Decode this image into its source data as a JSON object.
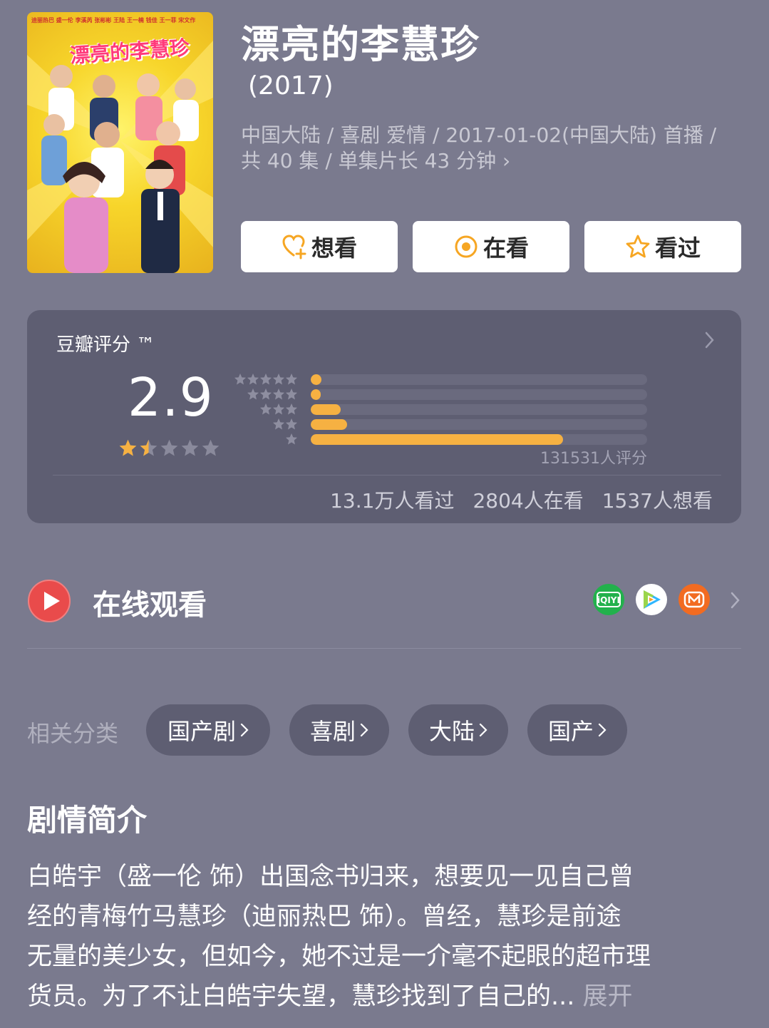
{
  "movie": {
    "poster": {
      "cast_names": "迪丽热巴  盛一伦  李溪芮  张彬彬  王陆  王一楠  钱佳  王一菲  宋文作",
      "title": "漂亮的李慧珍"
    },
    "title": "漂亮的李慧珍",
    "year": "(2017)",
    "meta_line1": "中国大陆 / 喜剧 爱情 / 2017-01-02(中国大陆) 首播 /",
    "meta_line2": "共 40 集 / 单集片长 43 分钟 ›"
  },
  "actions": {
    "want": "想看",
    "watching": "在看",
    "watched": "看过"
  },
  "rating": {
    "label": "豆瓣评分 ™",
    "score": "2.9",
    "stars_value": 1.5,
    "stars_max": 5,
    "distribution": [
      {
        "stars": 5,
        "fraction": 0.032
      },
      {
        "stars": 4,
        "fraction": 0.03
      },
      {
        "stars": 3,
        "fraction": 0.088
      },
      {
        "stars": 2,
        "fraction": 0.108
      },
      {
        "stars": 1,
        "fraction": 0.75
      }
    ],
    "count_text": "131531人评分",
    "stats": {
      "watched": "13.1万人看过",
      "watching": "2804人在看",
      "want": "1537人想看"
    }
  },
  "online": {
    "title": "在线观看",
    "platforms": [
      {
        "name": "iqiyi-icon",
        "label": "iQIYI",
        "color": "#22b14c"
      },
      {
        "name": "tencent-video-icon",
        "label": "",
        "color": "#ffffff"
      },
      {
        "name": "mgtv-icon",
        "label": "",
        "color": "#f26b21"
      }
    ]
  },
  "related": {
    "label": "相关分类",
    "tags": [
      "国产剧",
      "喜剧",
      "大陆",
      "国产"
    ]
  },
  "synopsis": {
    "title": "剧情简介",
    "lines": [
      "白皓宇（盛一伦 饰）出国念书归来，想要见一见自己曾",
      "经的青梅竹马慧珍（迪丽热巴 饰）。曾经，慧珍是前途",
      "无量的美少女，但如今，她不过是一介毫不起眼的超市理",
      "货员。为了不让白皓宇失望，慧珍找到了自己的..."
    ],
    "expand": "展开"
  },
  "colors": {
    "background": "#7a7a8e",
    "card": "#5e5e72",
    "bar_fill": "#f6b142",
    "star_filled": "#f6b142",
    "star_empty": "#8a8a9c",
    "play_red": "#e94b4b"
  }
}
